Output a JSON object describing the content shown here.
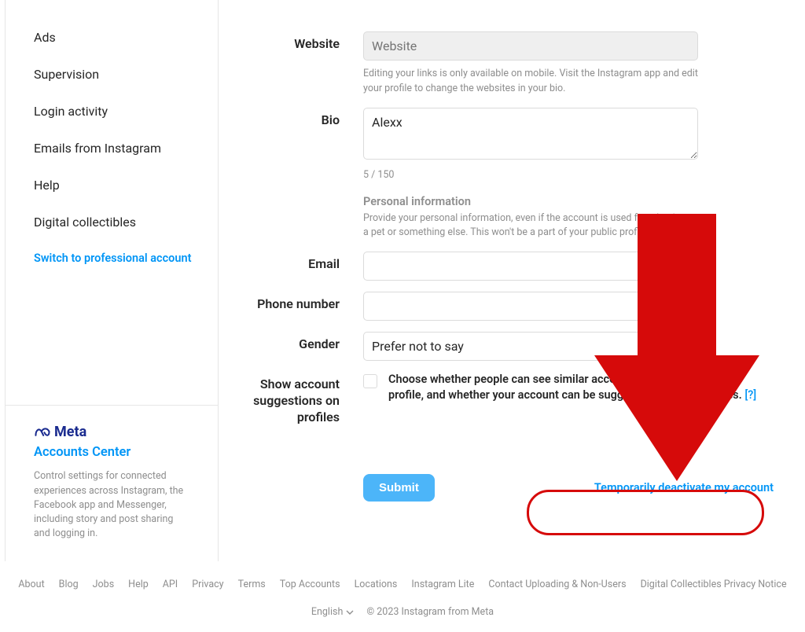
{
  "sidebar": {
    "items": [
      "Ads",
      "Supervision",
      "Login activity",
      "Emails from Instagram",
      "Help",
      "Digital collectibles"
    ],
    "switch": "Switch to professional account"
  },
  "accounts_center": {
    "brand": "Meta",
    "title": "Accounts Center",
    "desc": "Control settings for connected experiences across Instagram, the Facebook app and Messenger, including story and post sharing and logging in."
  },
  "form": {
    "website_label": "Website",
    "website_placeholder": "Website",
    "website_help": "Editing your links is only available on mobile. Visit the Instagram app and edit your profile to change the websites in your bio.",
    "bio_label": "Bio",
    "bio_value": "Alexx",
    "bio_count": "5 / 150",
    "personal_head": "Personal information",
    "personal_desc": "Provide your personal information, even if the account is used for a business, a pet or something else. This won't be a part of your public profile.",
    "email_label": "Email",
    "phone_label": "Phone number",
    "gender_label": "Gender",
    "gender_value": "Prefer not to say",
    "sugg_label_l1": "Show account",
    "sugg_label_l2": "suggestions on",
    "sugg_label_l3": "profiles",
    "sugg_desc": "Choose whether people can see similar account suggestions on your profile, and whether your account can be suggested on other profiles.",
    "sugg_help": "[?]",
    "submit": "Submit",
    "deactivate": "Temporarily deactivate my account"
  },
  "footer": {
    "links": [
      "About",
      "Blog",
      "Jobs",
      "Help",
      "API",
      "Privacy",
      "Terms",
      "Top Accounts",
      "Locations",
      "Instagram Lite",
      "Contact Uploading & Non-Users",
      "Digital Collectibles Privacy Notice"
    ],
    "lang": "English",
    "copy": "© 2023 Instagram from Meta"
  }
}
